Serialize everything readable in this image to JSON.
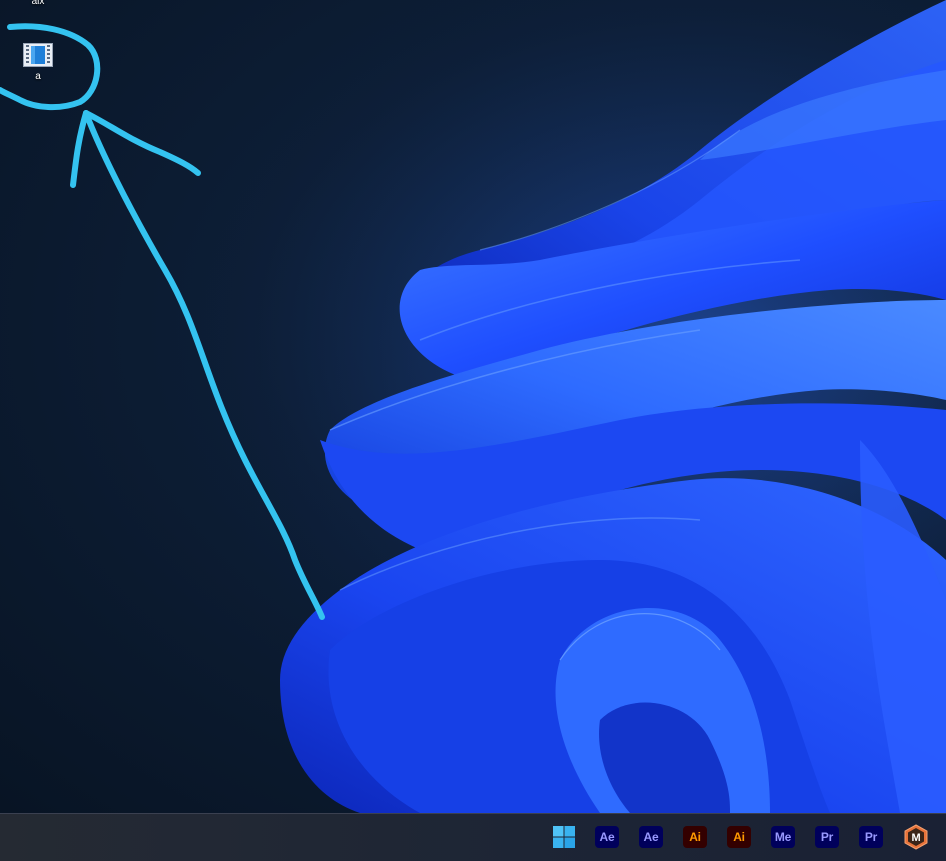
{
  "desktop": {
    "icons": [
      {
        "label": "aix",
        "icon": "file-icon"
      },
      {
        "label": "a",
        "icon": "video-file-icon"
      }
    ]
  },
  "taskbar": {
    "items": [
      {
        "label": "",
        "icon": "windows-start-icon"
      },
      {
        "label": "Ae",
        "icon": "after-effects-icon",
        "bg": "#00005b",
        "fg": "#9999ff"
      },
      {
        "label": "Ae",
        "icon": "after-effects-icon",
        "bg": "#00005b",
        "fg": "#9999ff"
      },
      {
        "label": "Ai",
        "icon": "illustrator-icon",
        "bg": "#330000",
        "fg": "#ff9a00"
      },
      {
        "label": "Ai",
        "icon": "illustrator-icon",
        "bg": "#330000",
        "fg": "#ff9a00"
      },
      {
        "label": "Me",
        "icon": "media-encoder-icon",
        "bg": "#00005b",
        "fg": "#9999ff"
      },
      {
        "label": "Pr",
        "icon": "premiere-pro-icon",
        "bg": "#00005b",
        "fg": "#9999ff"
      },
      {
        "label": "Pr",
        "icon": "premiere-pro-icon",
        "bg": "#00005b",
        "fg": "#9999ff"
      },
      {
        "label": "M",
        "icon": "m-app-icon",
        "bg": "#e8733a",
        "fg": "#ffffff"
      }
    ]
  },
  "colors": {
    "annotation_stroke": "#34c3f0",
    "wallpaper_blue": "#1f4fff"
  }
}
